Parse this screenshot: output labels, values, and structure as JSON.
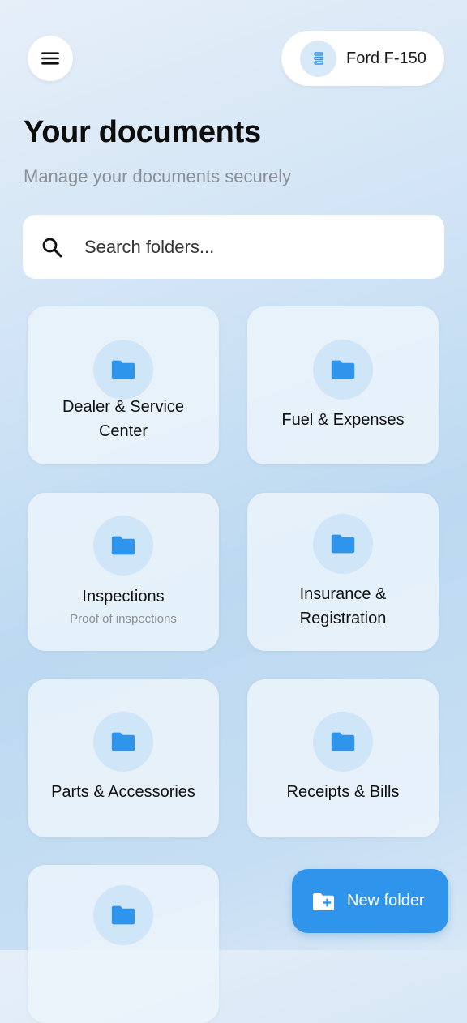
{
  "header": {
    "menu_icon": "hamburger-menu-icon",
    "vehicle": {
      "icon": "vehicle-info-icon",
      "name": "Ford F-150"
    }
  },
  "page": {
    "title": "Your documents",
    "subtitle": "Manage your documents securely"
  },
  "search": {
    "icon": "search-icon",
    "placeholder": "Search folders..."
  },
  "folders": [
    {
      "label_lines": [
        "Dealer & Service",
        "Center"
      ],
      "subtitle": ""
    },
    {
      "label_lines": [
        "Fuel & Expenses"
      ],
      "subtitle": ""
    },
    {
      "label_lines": [
        "Inspections"
      ],
      "subtitle": "Proof of inspections"
    },
    {
      "label_lines": [
        "Insurance &",
        "Registration"
      ],
      "subtitle": ""
    },
    {
      "label_lines": [
        "Parts & Accessories"
      ],
      "subtitle": ""
    },
    {
      "label_lines": [
        "Receipts & Bills"
      ],
      "subtitle": ""
    },
    {
      "label_lines": [],
      "subtitle": ""
    }
  ],
  "fab": {
    "icon": "new-folder-icon",
    "label": "New folder"
  },
  "colors": {
    "accent": "#2f95ec",
    "folder_icon": "#2f95ec",
    "folder_circle": "#cfe5f8",
    "card_background": "#ecf4fb"
  }
}
